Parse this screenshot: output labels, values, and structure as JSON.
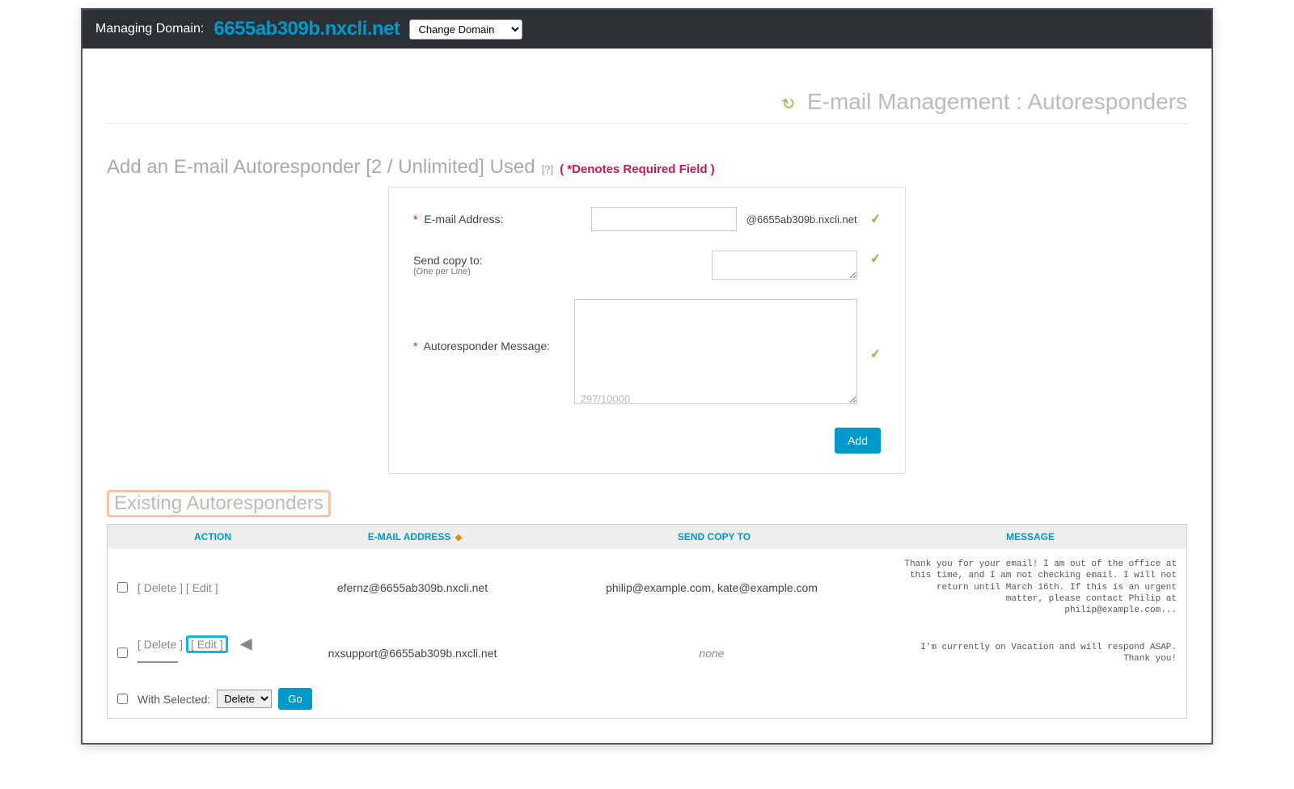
{
  "header": {
    "label": "Managing Domain:",
    "domain": "6655ab309b.nxcli.net",
    "change_domain_selected": "Change Domain"
  },
  "page": {
    "title": "E-mail Management : Autoresponders",
    "refresh_glyph": "↺"
  },
  "form": {
    "heading": "Add an E-mail Autoresponder [2 / Unlimited] Used",
    "help_link": "[?]",
    "required_note": "( *Denotes Required Field )",
    "labels": {
      "email": "E-mail Address:",
      "send_copy": "Send copy to:",
      "send_copy_sub": "(One per Line)",
      "message": "Autoresponder Message:"
    },
    "email_suffix": "@6655ab309b.nxcli.net",
    "char_counter": "297/10000",
    "add_button": "Add"
  },
  "existing": {
    "heading": "Existing Autoresponders",
    "columns": {
      "action": "ACTION",
      "email": "E-MAIL ADDRESS",
      "copy": "SEND COPY TO",
      "message": "MESSAGE"
    },
    "rows": [
      {
        "delete": "[ Delete ]",
        "edit": "[ Edit ]",
        "email": "efernz@6655ab309b.nxcli.net",
        "copy": "philip@example.com, kate@example.com",
        "copy_italic": false,
        "message": "Thank you for your email! I am out of the office at this time, and I am not checking email. I will not return until March 16th. If this is an urgent matter, please contact Philip at philip@example.com...",
        "highlight_edit": false
      },
      {
        "delete": "[ Delete ]",
        "edit": "[ Edit ]",
        "email": "nxsupport@6655ab309b.nxcli.net",
        "copy": "none",
        "copy_italic": true,
        "message": "I'm currently on Vacation and will respond ASAP.\nThank you!",
        "highlight_edit": true
      }
    ],
    "bulk": {
      "label": "With Selected:",
      "select": "Delete",
      "go": "Go"
    }
  },
  "annotation_arrow": "◀———"
}
